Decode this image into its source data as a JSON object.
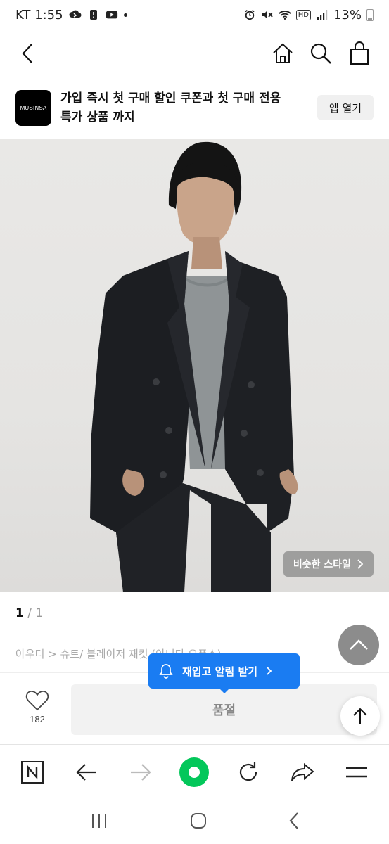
{
  "status_bar": {
    "carrier_time": "KT 1:55",
    "battery": "13%"
  },
  "top_nav": {
    "icons": [
      "back-icon",
      "home-icon",
      "search-icon",
      "shopping-bag-icon"
    ]
  },
  "app_banner": {
    "logo_text": "MUSINSA",
    "line1": "가입 즉시 첫 구매 할인 쿠폰과 첫 구매 전용",
    "line2": "특가 상품 까지",
    "open_button": "앱 열기"
  },
  "product": {
    "similar_style_label": "비슷한 스타일",
    "page_current": "1",
    "page_total": "1",
    "breadcrumb": "아우터 > 슈트/ 블레이저 재킷 (아니다 오픈스)"
  },
  "restock": {
    "label": "재입고 알림 받기"
  },
  "purchase_bar": {
    "like_count": "182",
    "soldout_label": "품절"
  },
  "browser_toolbar": {
    "icons": [
      "naver-n-icon",
      "back-arrow-icon",
      "forward-arrow-icon",
      "green-dot-icon",
      "refresh-icon",
      "share-icon",
      "menu-icon"
    ]
  },
  "colors": {
    "accent_blue": "#1a7cf2",
    "naver_green": "#03c75a"
  }
}
